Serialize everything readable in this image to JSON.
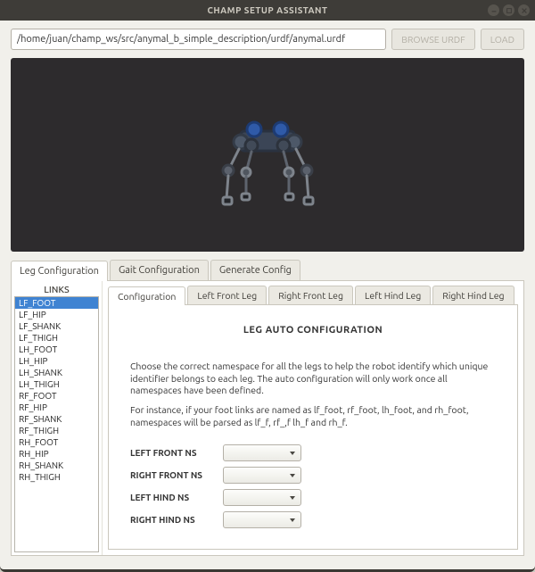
{
  "window": {
    "title": "CHAMP SETUP ASSISTANT"
  },
  "file_row": {
    "path_value": "/home/juan/champ_ws/src/anymal_b_simple_description/urdf/anymal.urdf",
    "browse_label": "BROWSE URDF",
    "load_label": "LOAD"
  },
  "main_tabs": {
    "items": [
      {
        "label": "Leg Configuration",
        "active": true
      },
      {
        "label": "Gait Configuration",
        "active": false
      },
      {
        "label": "Generate Config",
        "active": false
      }
    ]
  },
  "links_panel": {
    "title": "LINKS",
    "items": [
      "LF_FOOT",
      "LF_HIP",
      "LF_SHANK",
      "LF_THIGH",
      "LH_FOOT",
      "LH_HIP",
      "LH_SHANK",
      "LH_THIGH",
      "RF_FOOT",
      "RF_HIP",
      "RF_SHANK",
      "RF_THIGH",
      "RH_FOOT",
      "RH_HIP",
      "RH_SHANK",
      "RH_THIGH"
    ],
    "selected_index": 0
  },
  "sub_tabs": {
    "items": [
      {
        "label": "Configuration",
        "active": true
      },
      {
        "label": "Left Front Leg",
        "active": false
      },
      {
        "label": "Right Front Leg",
        "active": false
      },
      {
        "label": "Left Hind Leg",
        "active": false
      },
      {
        "label": "Right Hind Leg",
        "active": false
      }
    ]
  },
  "config_panel": {
    "heading": "LEG AUTO CONFIGURATION",
    "para1": "Choose the correct namespace for all the legs to help the robot identify which unique identifier belongs to each leg. The auto configuration will only work once all namespaces have been defined.",
    "para2": "For instance, if your foot links are named as lf_foot, rf_foot, lh_foot, and rh_foot, namespaces will be parsed as lf_f, rf_,f lh_f and rh_f.",
    "ns_rows": [
      {
        "label": "LEFT FRONT NS"
      },
      {
        "label": "RIGHT FRONT NS"
      },
      {
        "label": "LEFT HIND NS"
      },
      {
        "label": "RIGHT HIND NS"
      }
    ]
  }
}
